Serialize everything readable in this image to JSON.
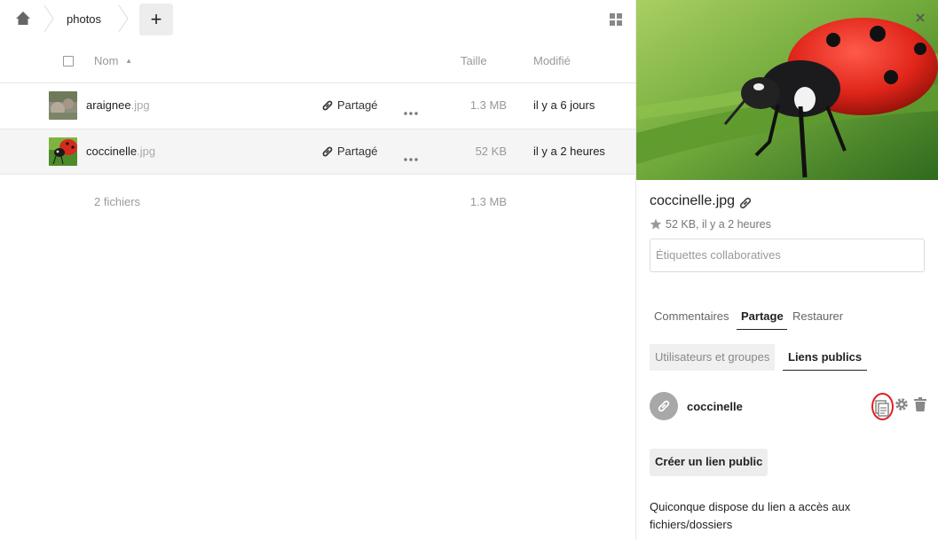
{
  "breadcrumb": {
    "current": "photos",
    "add_label": "+"
  },
  "list_header": {
    "name": "Nom",
    "size": "Taille",
    "modified": "Modifié"
  },
  "files": [
    {
      "name": "araignee",
      "ext": ".jpg",
      "share": "Partagé",
      "size": "1.3 MB",
      "modified": "il y a 6 jours"
    },
    {
      "name": "coccinelle",
      "ext": ".jpg",
      "share": "Partagé",
      "size": "52 KB",
      "modified": "il y a 2 heures"
    }
  ],
  "summary": {
    "count": "2 fichiers",
    "size": "1.3 MB"
  },
  "sidebar": {
    "filename": "coccinelle.jpg",
    "meta": "52 KB, il y a 2 heures",
    "tags_placeholder": "Étiquettes collaboratives",
    "tabs": [
      "Commentaires",
      "Partage",
      "Restaurer"
    ],
    "subtabs": [
      "Utilisateurs et groupes",
      "Liens publics"
    ],
    "public_link_name": "coccinelle",
    "create_label": "Créer un lien public",
    "hint": "Quiconque dispose du lien a accès aux fichiers/dossiers"
  },
  "colors": {
    "highlight_ring": "#e02020",
    "row_selected": "#f5f5f5"
  }
}
